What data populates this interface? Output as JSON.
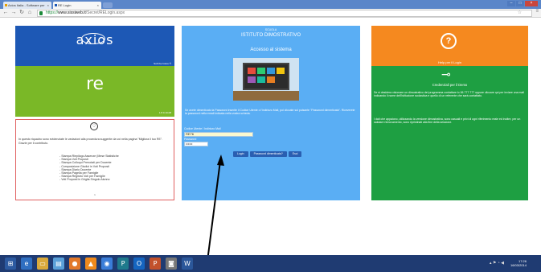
{
  "browser": {
    "tabs": [
      {
        "label": "Axios Italia - Software per",
        "active": false
      },
      {
        "label": "RE Login",
        "active": true
      }
    ],
    "close_glyph": "×",
    "url_scheme": "https://",
    "url_host": "www.sissiweb.it",
    "url_path": "/Secret/RELogin.aspx",
    "window_buttons": [
      "–",
      "□",
      "×"
    ]
  },
  "axios_tile": {
    "logo": "axios",
    "tagline": "Soft the future ®",
    "color": "#1d58b5"
  },
  "re_tile": {
    "logo": "re",
    "version": "1.8.0.10-08",
    "color": "#7ab827"
  },
  "notice": {
    "text": "In questo riquadro sono evidenziate le variazioni alla procedura suggerite da voi nella pagina \"Migliora il tuo RE\". Grazie per il contributo.",
    "items": [
      "- Stampa Riepilogo Assenze (Mese Statistiche",
      "- Stampa Voti Proposti",
      "- Stampa Colloqui Prenotati per Docente",
      "- Composizione Giudizi in Voti Proposti",
      "- Stampa Diario Docente",
      "- Stampa Pagella per Famiglie",
      "- Stampa Registro Voti per Famiglie",
      "- Voti Proposti in Griglia Singolo Alunno"
    ],
    "pager": "1"
  },
  "login": {
    "small_header": "SCUOLA",
    "school_name": "ISTITUTO DIMOSTRATIVO",
    "subtitle": "Accesso al sistema",
    "info": "Se avete dimenticato la Password inserite il Codice Utente o l'indirizzo Mail, poi cliccate sul pulsante \"Password dimenticata\". Riceverete la password nella email indicata nella vostra scheda.",
    "user_label": "Codice Utente / Indirizzo Mail",
    "user_value": "RE76",
    "password_label": "Password",
    "password_value": "••••••",
    "buttons": {
      "login": "Login",
      "forgot": "Password dimenticata?",
      "exit": "Esci"
    },
    "color": "#5aaef4"
  },
  "help_tile": {
    "label": "Help per il Login",
    "icon": "question-icon",
    "color": "#f5891f"
  },
  "demo_tile": {
    "title": "Credenziali per il Demo",
    "icon": "key-icon",
    "text1": "Se si desidera visionare un dimostrativo del programma contattare lo 06 777 777 oppure cliccare qui per inviare una mail indicando il nome dell'Istituzione scolastica e quello di un referente che sarà contattato.",
    "text2": "I dati che appaiono, utilizzando la versione dimostrativa, sono casuali e privi di ogni riferimento reale ed inoltre, per un salutare rinnovamento, sono ripristinati alla fine della sessione.",
    "color": "#1e9f42"
  },
  "taskbar": {
    "apps": [
      "start-icon",
      "ie-icon",
      "explorer-icon",
      "notes-icon",
      "firefox-icon",
      "vlc-icon",
      "chrome-icon",
      "publisher-icon",
      "outlook-icon",
      "powerpoint-icon",
      "camera-icon",
      "word-icon"
    ],
    "time": "17:26",
    "date": "16/03/2014"
  }
}
